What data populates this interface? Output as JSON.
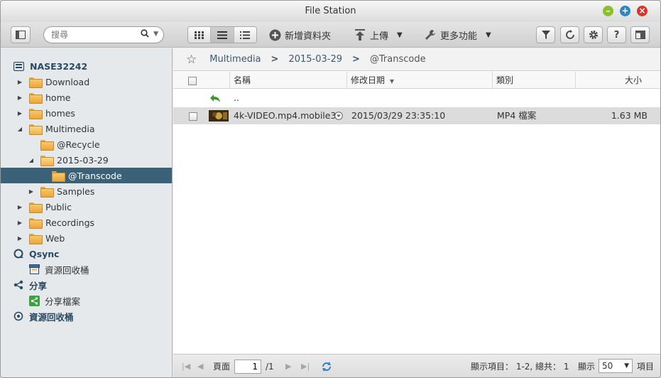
{
  "window": {
    "title": "File Station"
  },
  "toolbar": {
    "search_placeholder": "搜尋",
    "new_folder_label": "新增資料夾",
    "upload_label": "上傳",
    "more_label": "更多功能"
  },
  "sidebar": {
    "root": "NASE32242",
    "folders": [
      {
        "label": "Download"
      },
      {
        "label": "home"
      },
      {
        "label": "homes"
      },
      {
        "label": "Multimedia"
      },
      {
        "label": "@Recycle"
      },
      {
        "label": "2015-03-29"
      },
      {
        "label": "@Transcode"
      },
      {
        "label": "Samples"
      },
      {
        "label": "Public"
      },
      {
        "label": "Recordings"
      },
      {
        "label": "Web"
      }
    ],
    "qsync": "Qsync",
    "qsync_recycle": "資源回收桶",
    "share": "分享",
    "share_files": "分享檔案",
    "recycle": "資源回收桶"
  },
  "breadcrumb": [
    "Multimedia",
    "2015-03-29",
    "@Transcode"
  ],
  "columns": {
    "name": "名稱",
    "modified": "修改日期",
    "type": "類別",
    "size": "大小"
  },
  "files": [
    {
      "name": "..",
      "modified": "",
      "type": "",
      "size": ""
    },
    {
      "name": "4k-VIDEO.mp4.mobile3",
      "modified": "2015/03/29 23:35:10",
      "type": "MP4 檔案",
      "size": "1.63 MB"
    }
  ],
  "status": {
    "page_label": "頁面",
    "page_value": "1",
    "page_total": "/1",
    "display_info": "顯示項目： 1-2, 總共： 1",
    "display_label": "顯示",
    "per_page": "50",
    "items_label": "項目"
  },
  "colors": {
    "accent": "#3a6177",
    "folder": "#eba53a"
  }
}
